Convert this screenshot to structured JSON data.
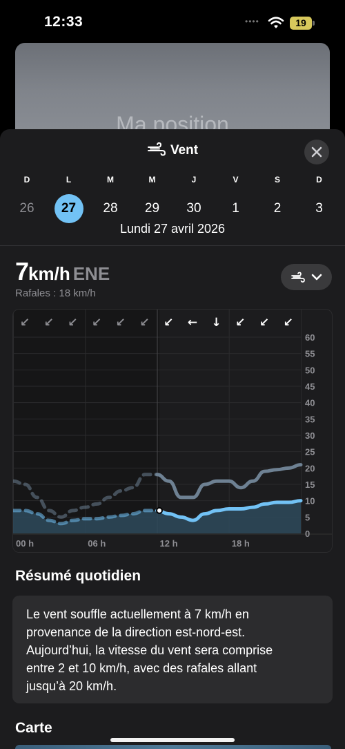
{
  "status_bar": {
    "time": "12:33",
    "battery": "19"
  },
  "background": {
    "location_title": "Ma position"
  },
  "sheet": {
    "title": "Vent",
    "icon": "wind-icon",
    "close_icon": "close-icon"
  },
  "week": {
    "days": [
      {
        "letter": "D",
        "num": "26",
        "state": "past"
      },
      {
        "letter": "L",
        "num": "27",
        "state": "selected"
      },
      {
        "letter": "M",
        "num": "28",
        "state": "future"
      },
      {
        "letter": "M",
        "num": "29",
        "state": "future"
      },
      {
        "letter": "J",
        "num": "30",
        "state": "future"
      },
      {
        "letter": "V",
        "num": "1",
        "state": "future"
      },
      {
        "letter": "S",
        "num": "2",
        "state": "future"
      },
      {
        "letter": "D",
        "num": "3",
        "state": "future"
      }
    ],
    "selected_date": "Lundi 27 avril 2026"
  },
  "current": {
    "speed": "7",
    "unit": "km/h",
    "direction": "ENE",
    "gusts": "Rafales : 18 km/h"
  },
  "chart_data": {
    "type": "line",
    "x_unit": "hour",
    "x_ticks": [
      "00 h",
      "06 h",
      "12 h",
      "18 h"
    ],
    "y_ticks": [
      "0",
      "5",
      "10",
      "15",
      "20",
      "25",
      "30",
      "35",
      "40",
      "45",
      "50",
      "55",
      "60"
    ],
    "ylim": [
      0,
      60
    ],
    "xlim": [
      0,
      24
    ],
    "now_hour": 12.2,
    "direction_arrows": [
      "↙",
      "↙",
      "↙",
      "↙",
      "↙",
      "↙",
      "↙",
      "←",
      "↓",
      "↙",
      "↙",
      "↙"
    ],
    "series": [
      {
        "x": [
          0,
          1,
          2,
          3,
          4,
          5,
          6,
          7,
          8,
          9,
          10,
          11,
          12,
          13,
          14,
          15,
          16,
          17,
          18,
          19,
          20,
          21,
          22,
          23,
          24
        ],
        "values": [
          7,
          7,
          6,
          4,
          3,
          4,
          4.5,
          4.5,
          5,
          5.5,
          6,
          7,
          7,
          6,
          5,
          4,
          6,
          7,
          7.5,
          7.5,
          8,
          9,
          9.5,
          9.5,
          10
        ],
        "color": "#72c2f5"
      },
      {
        "x": [
          0,
          1,
          2,
          3,
          4,
          5,
          6,
          7,
          8,
          9,
          10,
          11,
          12,
          13,
          14,
          15,
          16,
          17,
          18,
          19,
          20,
          21,
          22,
          23,
          24
        ],
        "values": [
          16,
          15,
          11,
          7,
          5,
          7,
          8,
          9,
          11,
          13,
          14,
          18,
          18,
          16,
          11,
          11,
          15,
          16,
          16,
          14,
          16,
          19,
          19.5,
          20,
          21
        ],
        "color": "#6e8193"
      }
    ]
  },
  "summary": {
    "title": "Résumé quotidien",
    "lines": [
      "Le vent souffle actuellement à 7 km/h en",
      "provenance de la direction est-nord-est.",
      "Aujourd’hui, la vitesse du vent sera comprise",
      "entre 2 et 10 km/h, avec des rafales allant",
      "jusqu’à 20 km/h."
    ]
  },
  "map": {
    "title": "Carte"
  }
}
